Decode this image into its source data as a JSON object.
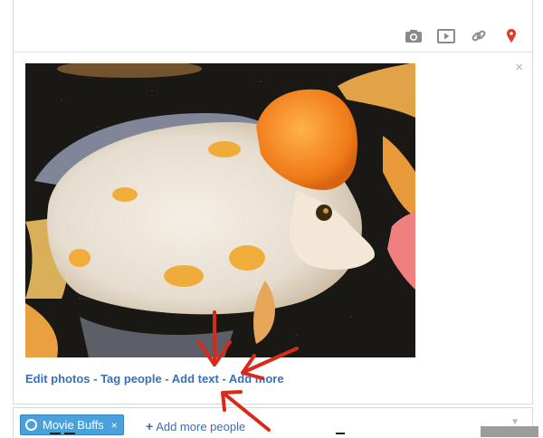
{
  "composer": {
    "toolbar": {
      "icons": [
        "camera-icon",
        "video-icon",
        "link-icon",
        "location-pin-icon"
      ]
    },
    "photo": {
      "subject": "fish-photo"
    },
    "actions": {
      "edit_photos": "Edit photos",
      "tag_people": "Tag people",
      "add_text": "Add text",
      "add_more": "Add more",
      "separator": " - "
    },
    "close_symbol": "×"
  },
  "share": {
    "chip_label": "Movie Buffs",
    "chip_remove": "×",
    "add_more_people": "Add more people",
    "add_prefix": "+"
  },
  "colors": {
    "link": "#3a6fb5",
    "chip": "#4aa0d8",
    "annotation_arrow": "#d62a1a"
  }
}
